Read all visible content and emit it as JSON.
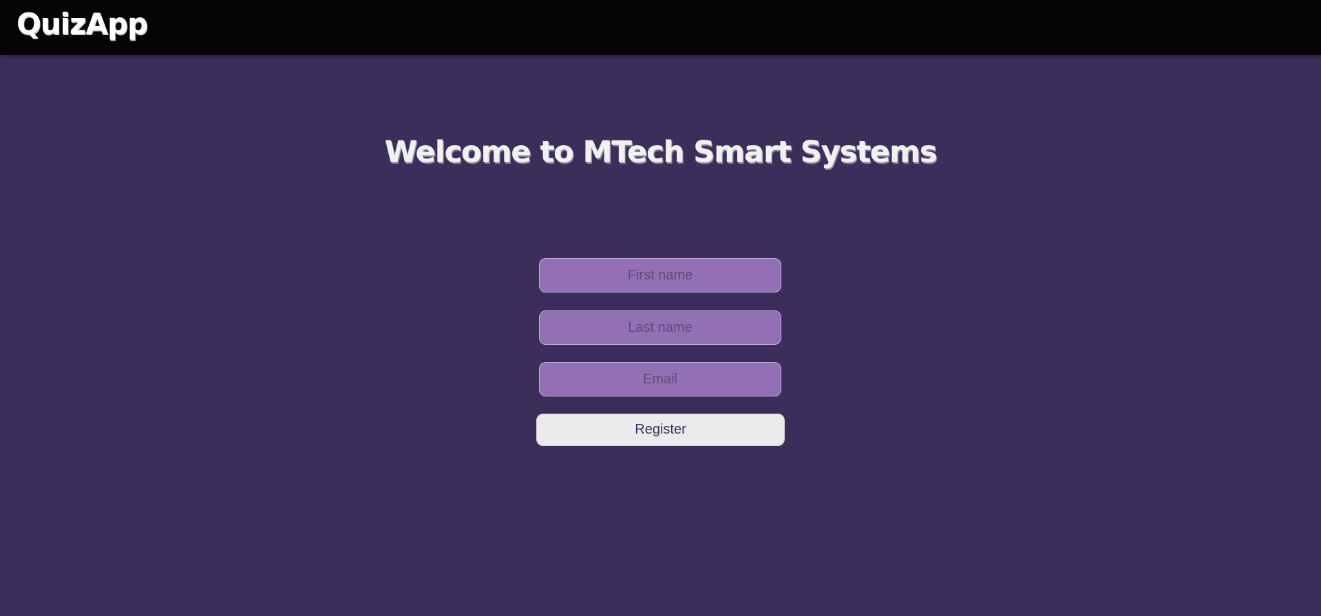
{
  "header": {
    "brand": "QuizApp"
  },
  "main": {
    "title": "Welcome to MTech Smart Systems"
  },
  "form": {
    "first_name": {
      "placeholder": "First name",
      "value": ""
    },
    "last_name": {
      "placeholder": "Last name",
      "value": ""
    },
    "email": {
      "placeholder": "Email",
      "value": ""
    },
    "register_label": "Register"
  },
  "colors": {
    "header_bg": "#050505",
    "page_bg": "#3c2e5b",
    "input_bg": "#9370b5",
    "button_bg": "#ebebeb"
  }
}
